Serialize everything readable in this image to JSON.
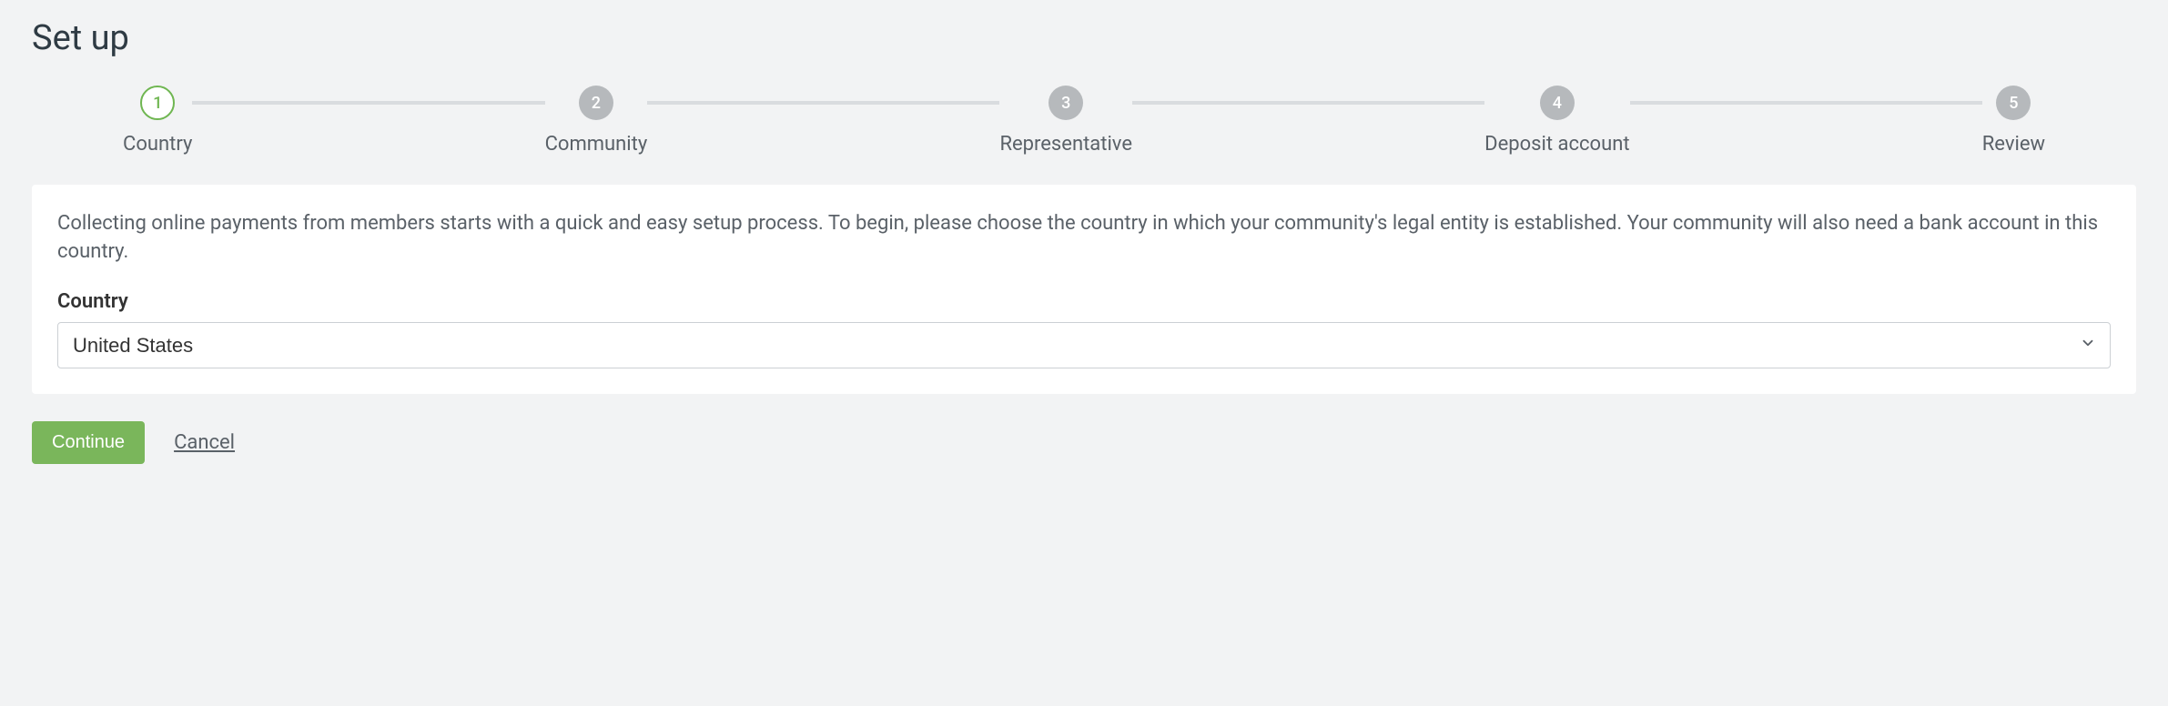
{
  "title": "Set up",
  "steps": [
    {
      "num": "1",
      "label": "Country"
    },
    {
      "num": "2",
      "label": "Community"
    },
    {
      "num": "3",
      "label": "Representative"
    },
    {
      "num": "4",
      "label": "Deposit account"
    },
    {
      "num": "5",
      "label": "Review"
    }
  ],
  "card": {
    "description": "Collecting online payments from members starts with a quick and easy setup process. To begin, please choose the country in which your community's legal entity is established. Your community will also need a bank account in this country.",
    "country_label": "Country",
    "country_value": "United States"
  },
  "actions": {
    "continue": "Continue",
    "cancel": "Cancel"
  }
}
